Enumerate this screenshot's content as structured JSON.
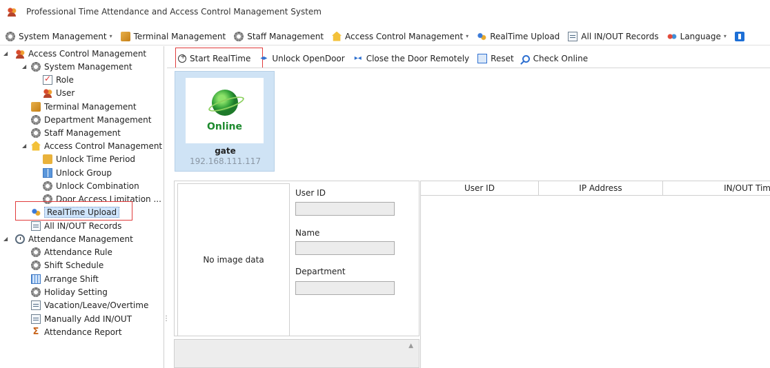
{
  "window": {
    "title": "Professional Time Attendance and Access Control Management System"
  },
  "menu": [
    {
      "label": "System Management",
      "icon": "gear-icon",
      "dropdown": true
    },
    {
      "label": "Terminal Management",
      "icon": "box-icon",
      "dropdown": false
    },
    {
      "label": "Staff Management",
      "icon": "gear-icon",
      "dropdown": false
    },
    {
      "label": "Access Control Management",
      "icon": "house-icon",
      "dropdown": true
    },
    {
      "label": "RealTime Upload",
      "icon": "upload-icon",
      "dropdown": false
    },
    {
      "label": "All IN/OUT Records",
      "icon": "document-icon",
      "dropdown": false
    },
    {
      "label": "Language",
      "icon": "language-icon",
      "dropdown": true
    }
  ],
  "sidebar": {
    "root": "Access Control Management",
    "system_management": "System Management",
    "role": "Role",
    "user": "User",
    "terminal_management": "Terminal Management",
    "department_management": "Department Management",
    "staff_management": "Staff Management",
    "access_control_management": "Access Control Management",
    "unlock_time_period": "Unlock Time Period",
    "unlock_group": "Unlock Group",
    "unlock_combination": "Unlock Combination",
    "door_access_limitation": "Door Access Limitation ...",
    "realtime_upload": "RealTime Upload",
    "all_inout_records": "All IN/OUT Records",
    "attendance_management": "Attendance Management",
    "attendance_rule": "Attendance Rule",
    "shift_schedule": "Shift Schedule",
    "arrange_shift": "Arrange Shift",
    "holiday_setting": "Holiday Setting",
    "vacation": "Vacation/Leave/Overtime",
    "manually_add": "Manually Add IN/OUT",
    "attendance_report": "Attendance Report",
    "selected": "RealTime Upload"
  },
  "toolbar": {
    "start_realtime": "Start RealTime",
    "unlock_opendoor": "Unlock OpenDoor",
    "close_door": "Close the Door Remotely",
    "reset": "Reset",
    "check_online": "Check Online"
  },
  "device": {
    "status": "Online",
    "name": "gate",
    "ip": "192.168.111.117"
  },
  "detail": {
    "no_image": "No image data",
    "user_id_label": "User ID",
    "user_id_value": "",
    "name_label": "Name",
    "name_value": "",
    "department_label": "Department",
    "department_value": ""
  },
  "records": {
    "columns": [
      "User ID",
      "IP Address",
      "IN/OUT Tim"
    ]
  },
  "colors": {
    "highlight": "#e03a3a",
    "selected_bg": "#cfe5fc",
    "device_tile": "#cfe3f5",
    "online": "#1d8a2e"
  }
}
